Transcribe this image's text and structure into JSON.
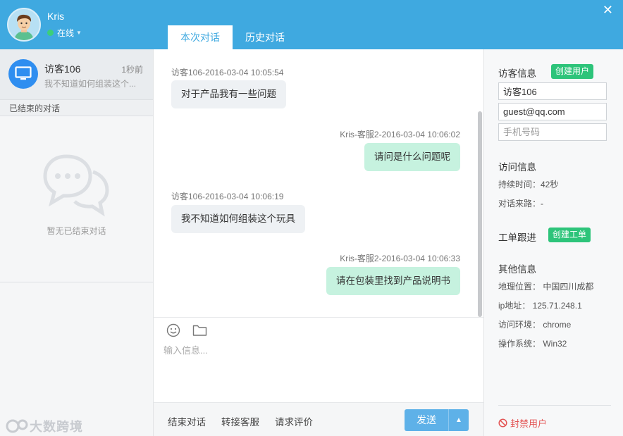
{
  "agent": {
    "name": "Kris",
    "status": "在线"
  },
  "tabs": [
    {
      "label": "本次对话",
      "active": true
    },
    {
      "label": "历史对话",
      "active": false
    }
  ],
  "sidebar": {
    "conversation": {
      "name": "访客106",
      "time": "1秒前",
      "preview": "我不知道如何组装这个..."
    },
    "ended_header": "已结束的对话",
    "empty_text": "暂无已结束对话",
    "watermark": "大数跨境"
  },
  "messages": [
    {
      "direction": "in",
      "meta": "访客106-2016-03-04 10:05:54",
      "text": "对于产品我有一些问题"
    },
    {
      "direction": "out",
      "meta": "Kris-客服2-2016-03-04 10:06:02",
      "text": "请问是什么问题呢"
    },
    {
      "direction": "in",
      "meta": "访客106-2016-03-04 10:06:19",
      "text": "我不知道如何组装这个玩具"
    },
    {
      "direction": "out",
      "meta": "Kris-客服2-2016-03-04 10:06:33",
      "text": "请在包装里找到产品说明书"
    }
  ],
  "composer": {
    "placeholder": "输入信息...",
    "end_label": "结束对话",
    "transfer_label": "转接客服",
    "rate_label": "请求评价",
    "send_label": "发送"
  },
  "visitor": {
    "title": "访客信息",
    "create_user_label": "创建用户",
    "name_value": "访客106",
    "email_value": "guest@qq.com",
    "phone_placeholder": "手机号码"
  },
  "visit": {
    "title": "访问信息",
    "duration": "持续时间：42秒",
    "source": "对话来路：-"
  },
  "ticket": {
    "title": "工单跟进",
    "create_ticket_label": "创建工单"
  },
  "other": {
    "title": "其他信息",
    "location": "地理位置： 中国四川成都",
    "ip": "ip地址： 125.71.248.1",
    "env": "访问环境： chrome",
    "os": "操作系统： Win32"
  },
  "ban_label": "封禁用户",
  "colors": {
    "header": "#3fa9e0",
    "accent_green": "#2dc47a",
    "bubble_out": "#c6f2df",
    "bubble_in": "#eef1f4",
    "send": "#5eb1e8",
    "ban": "#e35454"
  }
}
